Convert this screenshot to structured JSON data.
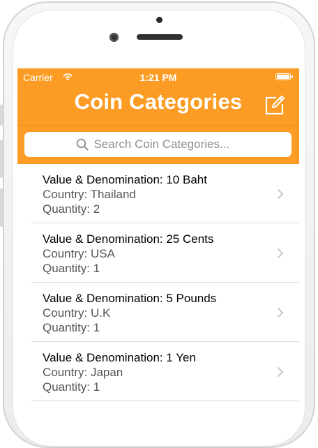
{
  "status_bar": {
    "carrier": "Carrier",
    "time": "1:21 PM",
    "wifi_icon": "wifi-icon",
    "battery_icon": "battery-icon"
  },
  "nav": {
    "title": "Coin Categories",
    "compose_icon": "compose-icon",
    "accent_color": "#fd9c24"
  },
  "search": {
    "placeholder": "Search Coin Categories...",
    "value": ""
  },
  "coins": [
    {
      "denomination": "Value & Denomination: 10 Baht",
      "country": "Country: Thailand",
      "quantity": "Quantity: 2"
    },
    {
      "denomination": "Value & Denomination: 25 Cents",
      "country": "Country: USA",
      "quantity": "Quantity: 1"
    },
    {
      "denomination": "Value & Denomination: 5 Pounds",
      "country": "Country: U.K",
      "quantity": "Quantity: 1"
    },
    {
      "denomination": "Value & Denomination: 1 Yen",
      "country": "Country: Japan",
      "quantity": "Quantity: 1"
    }
  ]
}
